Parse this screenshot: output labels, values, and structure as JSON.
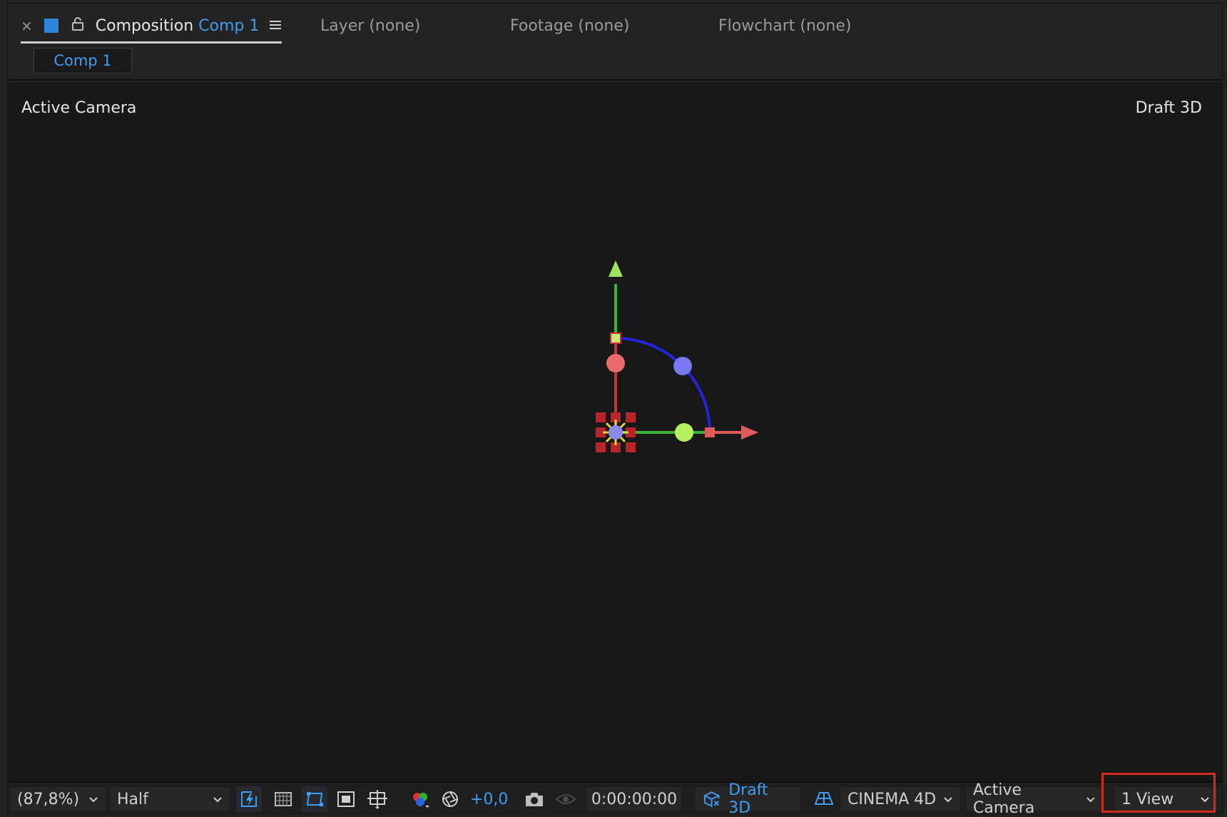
{
  "header": {
    "close_glyph": "×",
    "composition_label": "Composition",
    "composition_name": "Comp 1",
    "tabs": [
      {
        "label": "Layer (none)"
      },
      {
        "label": "Footage (none)"
      },
      {
        "label": "Flowchart (none)"
      }
    ],
    "subtab_label": "Comp 1"
  },
  "viewer": {
    "left_label": "Active Camera",
    "right_label": "Draft 3D"
  },
  "toolbar": {
    "magnification": "(87,8%)",
    "resolution": "Half",
    "exposure": "+0,0",
    "timecode": "0:00:00:00",
    "draft3d_label": "Draft 3D",
    "renderer": "CINEMA 4D",
    "camera_view": "Active Camera",
    "view_layout": "1 View"
  },
  "colors": {
    "accent": "#3f9cf0",
    "highlight": "#d42a1f",
    "axis_x": "#e05a5a",
    "axis_y": "#9be35f",
    "axis_z": "#2424d8"
  },
  "icons": [
    "close-icon",
    "composition-swatch-icon",
    "lock-icon",
    "panel-menu-icon",
    "chevron-down-icon",
    "fast-previews-icon",
    "transparency-grid-icon",
    "mask-visibility-icon",
    "region-of-interest-icon",
    "grid-guides-icon",
    "channel-rgb-icon",
    "reset-exposure-icon",
    "camera-snapshot-icon",
    "show-snapshot-icon",
    "draft-3d-icon",
    "ground-plane-icon"
  ]
}
